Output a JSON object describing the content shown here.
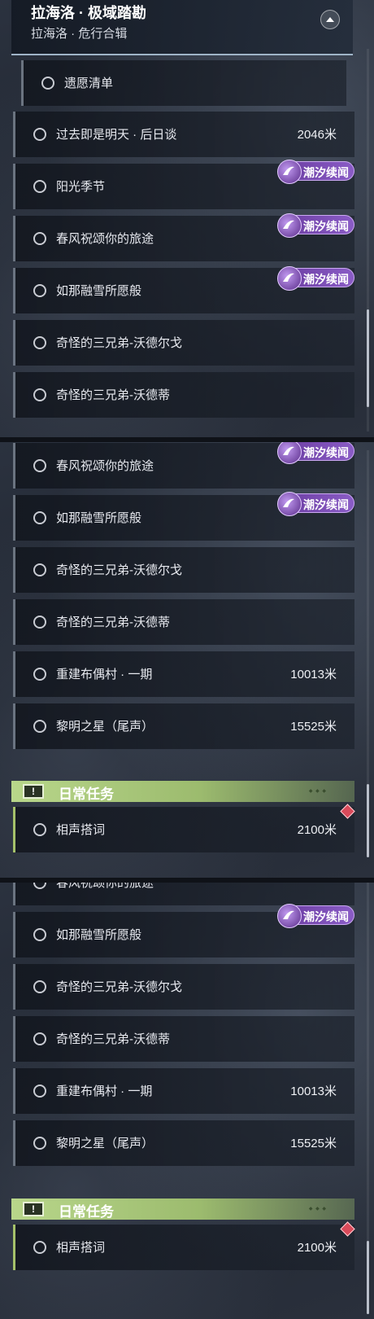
{
  "panel1": {
    "header": {
      "title": "拉海洛 · 极域踏勘",
      "subtitle": "拉海洛 · 危行合辑"
    },
    "rows": [
      {
        "label": "遗愿清单",
        "distance": "",
        "badge": false,
        "sub": true
      },
      {
        "label": "过去即是明天 · 后日谈",
        "distance": "2046米",
        "badge": false
      },
      {
        "label": "阳光季节",
        "distance": "",
        "badge": true
      },
      {
        "label": "春风祝颂你的旅途",
        "distance": "",
        "badge": true
      },
      {
        "label": "如那融雪所愿般",
        "distance": "",
        "badge": true
      },
      {
        "label": "奇怪的三兄弟-沃德尔戈",
        "distance": "",
        "badge": false
      },
      {
        "label": "奇怪的三兄弟-沃德蒂",
        "distance": "",
        "badge": false
      }
    ]
  },
  "panel2": {
    "rows": [
      {
        "label": "春风祝颂你的旅途",
        "distance": "",
        "badge": true
      },
      {
        "label": "如那融雪所愿般",
        "distance": "",
        "badge": true
      },
      {
        "label": "奇怪的三兄弟-沃德尔戈",
        "distance": "",
        "badge": false
      },
      {
        "label": "奇怪的三兄弟-沃德蒂",
        "distance": "",
        "badge": false
      },
      {
        "label": "重建布偶村 · 一期",
        "distance": "10013米",
        "badge": false
      },
      {
        "label": "黎明之星（尾声）",
        "distance": "15525米",
        "badge": false
      }
    ],
    "daily": {
      "title": "日常任务",
      "icon": "!",
      "row": {
        "label": "相声搭词",
        "distance": "2100米"
      }
    }
  },
  "panel3": {
    "rows": [
      {
        "label": "春风祝颂你的旅途",
        "distance": "",
        "badge": false
      },
      {
        "label": "如那融雪所愿般",
        "distance": "",
        "badge": true
      },
      {
        "label": "奇怪的三兄弟-沃德尔戈",
        "distance": "",
        "badge": false
      },
      {
        "label": "奇怪的三兄弟-沃德蒂",
        "distance": "",
        "badge": false
      },
      {
        "label": "重建布偶村 · 一期",
        "distance": "10013米",
        "badge": false
      },
      {
        "label": "黎明之星（尾声）",
        "distance": "15525米",
        "badge": false
      }
    ],
    "daily": {
      "title": "日常任务",
      "icon": "!",
      "row": {
        "label": "相声搭词",
        "distance": "2100米"
      }
    }
  },
  "tide_badge_label": "潮汐续闻",
  "colors": {
    "tide_badge": "#7a4bb4",
    "daily_header": "#b1cf84",
    "diamond_badge": "#d94a5a"
  }
}
